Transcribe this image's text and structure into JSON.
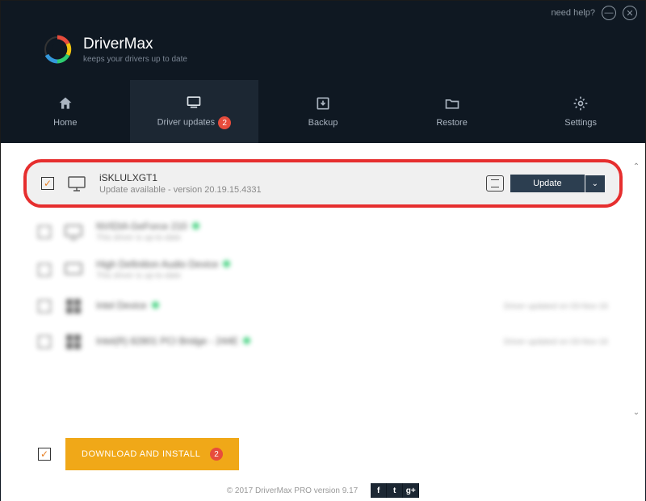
{
  "titlebar": {
    "help": "need help?"
  },
  "brand": {
    "title": "DriverMax",
    "subtitle": "keeps your drivers up to date"
  },
  "tabs": {
    "home": "Home",
    "updates": "Driver updates",
    "updates_badge": "2",
    "backup": "Backup",
    "restore": "Restore",
    "settings": "Settings"
  },
  "drivers": {
    "highlighted": {
      "name": "iSKLULXGT1",
      "status": "Update available - version 20.19.15.4331",
      "update_btn": "Update"
    },
    "rows": [
      {
        "name": "NVIDIA GeForce 210",
        "status": "This driver is up-to-date",
        "right": ""
      },
      {
        "name": "High Definition Audio Device",
        "status": "This driver is up-to-date",
        "right": ""
      },
      {
        "name": "Intel Device",
        "status": "",
        "right": "Driver updated on 03-Nov-16"
      },
      {
        "name": "Intel(R) 82801 PCI Bridge - 244E",
        "status": "",
        "right": "Driver updated on 03-Nov-16"
      }
    ]
  },
  "bottom": {
    "download": "DOWNLOAD AND INSTALL",
    "badge": "2"
  },
  "footer": {
    "copyright": "© 2017 DriverMax PRO version 9.17"
  }
}
